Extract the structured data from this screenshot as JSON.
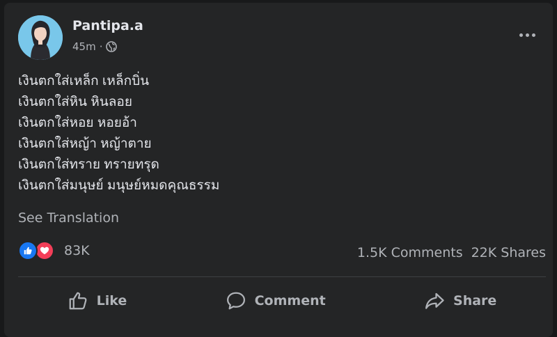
{
  "post": {
    "author": "Pantipa.a",
    "time": "45m",
    "separator": "·",
    "audience_icon": "globe-icon",
    "lines": [
      "เงินตกใส่เหล็ก เหล็กบิ่น",
      "เงินตกใส่หิน หินลอย",
      "เงินตกใส่หอย หอยอ้า",
      "เงินตกใส่หญ้า หญ้าตาย",
      "เงินตกใส่ทราย ทรายทรุด",
      "เงินตกใส่มนุษย์ มนุษย์หมดคุณธรรม"
    ],
    "see_translation": "See Translation"
  },
  "engagement": {
    "reaction_icons": [
      "like-icon",
      "love-icon"
    ],
    "reaction_count": "83K",
    "comments": "1.5K Comments",
    "shares": "22K Shares"
  },
  "actions": {
    "like": "Like",
    "comment": "Comment",
    "share": "Share"
  },
  "colors": {
    "background": "#18191a",
    "card": "#242526",
    "text_primary": "#e4e6eb",
    "text_secondary": "#b0b3b8",
    "like_blue": "#1877f2",
    "love_red": "#f33e58"
  }
}
